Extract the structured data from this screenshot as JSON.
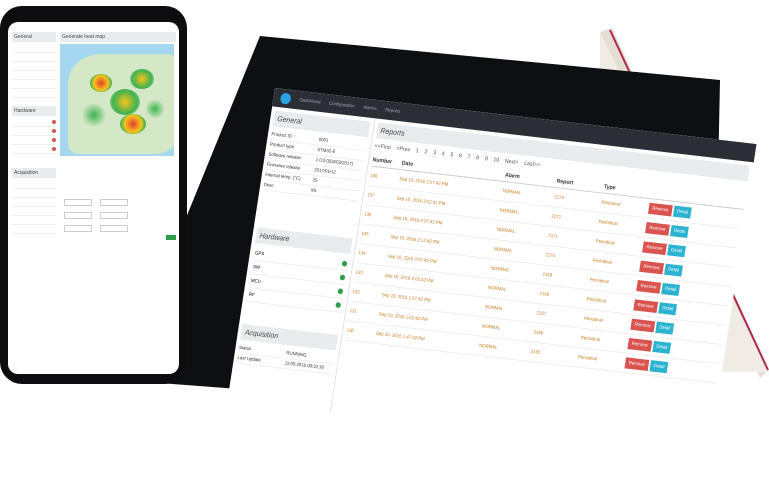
{
  "tablet": {
    "app_nav": [
      "Dashboard",
      "Configuration",
      "Alarms",
      "Reports"
    ],
    "general": {
      "title": "General",
      "fields": [
        {
          "k": "Product ID",
          "v": "0001"
        },
        {
          "k": "Product type",
          "v": "STM32-E"
        },
        {
          "k": "Software release",
          "v": "1.0.0.0[04/03/2017]"
        },
        {
          "k": "Firmware release",
          "v": "2017/01/12"
        },
        {
          "k": "Internal temp. (°C)",
          "v": "25"
        },
        {
          "k": "Desc",
          "v": "ML"
        }
      ]
    },
    "hardware": {
      "title": "Hardware",
      "items": [
        "GPS",
        "SW",
        "MCU",
        "RF"
      ]
    },
    "acquisition": {
      "title": "Acquisition",
      "fields": [
        {
          "k": "Status",
          "v": "RUNNING"
        },
        {
          "k": "Last Update",
          "v": "11:05:2016 08:32:30"
        }
      ]
    },
    "reports": {
      "title": "Reports",
      "pager": [
        "<<First",
        "<Prev",
        "1",
        "2",
        "3",
        "4",
        "5",
        "6",
        "7",
        "8",
        "9",
        "10",
        "Next>",
        "Last>>"
      ],
      "headers": [
        "Number",
        "Date",
        "Alarm",
        "Report",
        "Type"
      ],
      "rows": [
        {
          "num": "138",
          "date": "Sep 10, 2016 2:27:42 PM",
          "alarm": "NORMAL",
          "report": "2173",
          "type": "Periodical"
        },
        {
          "num": "137",
          "date": "Sep 10, 2016 2:22:42 PM",
          "alarm": "NORMAL",
          "report": "2172",
          "type": "Periodical"
        },
        {
          "num": "136",
          "date": "Sep 10, 2016 2:17:42 PM",
          "alarm": "NORMAL",
          "report": "2171",
          "type": "Periodical"
        },
        {
          "num": "135",
          "date": "Sep 10, 2016 2:12:42 PM",
          "alarm": "NORMAL",
          "report": "2170",
          "type": "Periodical"
        },
        {
          "num": "134",
          "date": "Sep 10, 2016 2:07:42 PM",
          "alarm": "NORMAL",
          "report": "2169",
          "type": "Periodical"
        },
        {
          "num": "133",
          "date": "Sep 10, 2016 2:02:42 PM",
          "alarm": "NORMAL",
          "report": "2168",
          "type": "Periodical"
        },
        {
          "num": "132",
          "date": "Sep 10, 2016 1:57:42 PM",
          "alarm": "NORMAL",
          "report": "2167",
          "type": "Periodical"
        },
        {
          "num": "131",
          "date": "Sep 10, 2016 1:52:42 PM",
          "alarm": "NORMAL",
          "report": "2166",
          "type": "Periodical"
        },
        {
          "num": "130",
          "date": "Sep 10, 2016 1:47:42 PM",
          "alarm": "NORMAL",
          "report": "2165",
          "type": "Periodical"
        }
      ],
      "remove_label": "Remove",
      "detail_label": "Detail"
    }
  },
  "phone": {
    "general_title": "General",
    "map_title": "Generate heat map",
    "hardware_title": "Hardware",
    "acquisition_title": "Acquisition"
  },
  "colors": {
    "header": "#2b2f35",
    "remove": "#d9534f",
    "detail": "#2bb3d1",
    "status_ok": "#2e9e4d",
    "value_text": "#c77a1a"
  }
}
